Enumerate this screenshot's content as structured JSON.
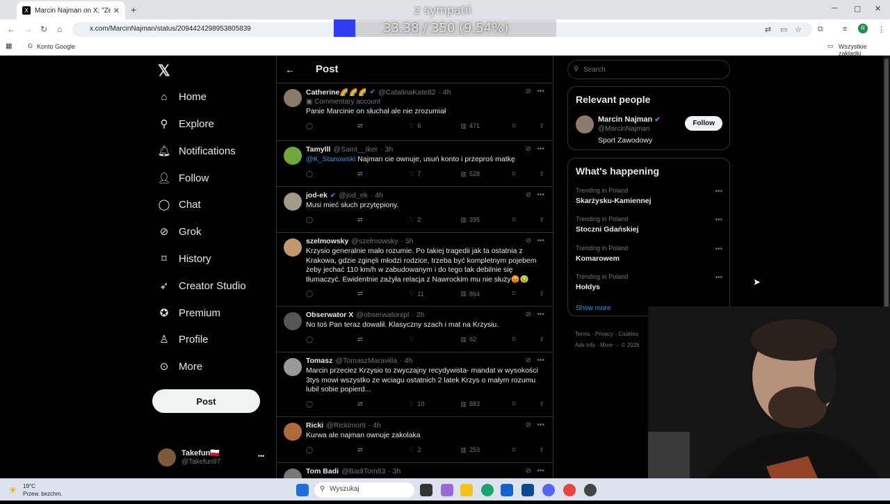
{
  "browser": {
    "tab_title": "Marcin Najman on X: \"Ze wszy",
    "tab_close": "✕",
    "new_tab": "+",
    "url": "x.com/MarcinNajman/status/2094424298953805839",
    "bookmark_google": "Konto Google",
    "bookmark_all": "Wszystkie zakładki",
    "window_min": "─",
    "window_max": "▢",
    "window_close": "✕"
  },
  "overlay": {
    "line1": "z sympatii",
    "line2": "33.38 / 350 (9.54%)",
    "overlay_color": "#2f3cf2",
    "overlay_progress": 0.0954
  },
  "sidebar": {
    "items": [
      {
        "label": "Home",
        "icon": "home-icon"
      },
      {
        "label": "Explore",
        "icon": "search-icon"
      },
      {
        "label": "Notifications",
        "icon": "bell-icon"
      },
      {
        "label": "Follow",
        "icon": "add-user-icon"
      },
      {
        "label": "Chat",
        "icon": "chat-icon"
      },
      {
        "label": "Grok",
        "icon": "grok-icon"
      },
      {
        "label": "History",
        "icon": "bookmark-icon"
      },
      {
        "label": "Creator Studio",
        "icon": "rocket-icon"
      },
      {
        "label": "Premium",
        "icon": "verified-icon"
      },
      {
        "label": "Profile",
        "icon": "person-icon"
      },
      {
        "label": "More",
        "icon": "more-circle-icon"
      }
    ],
    "post_button": "Post",
    "account": {
      "name": "Takefun🇵🇱",
      "handle": "@Takefun97",
      "menu": "•••"
    }
  },
  "main": {
    "back": "←",
    "title": "Post",
    "tweets": [
      {
        "name": "Catherine🌈🌈🌈",
        "handle": "@CatalinaKate82",
        "time": "· 4h",
        "verified": true,
        "badge": "Commentary account",
        "text": "Panie Marcinie on słuchał ale nie zrozumiał",
        "likes": "6",
        "views": "471"
      },
      {
        "name": "Tamylll",
        "handle": "@Saint__Iker",
        "time": "· 3h",
        "mention": "@K_Stanowski",
        "text": " Najman cie ownuje, usuń konto i przeproś matkę",
        "likes": "7",
        "views": "528"
      },
      {
        "name": "jod-ek",
        "handle": "@jod_ek",
        "time": "· 4h",
        "verified": true,
        "text": "Musi mieć słuch przytępiony.",
        "likes": "2",
        "views": "395"
      },
      {
        "name": "szelmowsky",
        "handle": "@szelmowsky",
        "time": "· 5h",
        "text": "Krzysio generalnie mało rozumie. Po takiej tragedii jak ta ostatnia z Krakowa, gdzie zginęli młodzi rodzice, trzeba być kompletnym pojebem żeby jechać 110 km/h w zabudowanym i do tego tak debilnie się tłumaczyć. Ewidentnie zażyła relacja z Nawrockim mu nie służy😡🤢",
        "likes": "11",
        "views": "864"
      },
      {
        "name": "Obserwator X",
        "handle": "@obserwatorxpl",
        "time": "· 2h",
        "text": "No toś Pan teraz dowalił. Klasyczny szach i mat na Krzysiu.",
        "likes": "",
        "views": "62"
      },
      {
        "name": "Tomasz",
        "handle": "@TomaszMaravilla",
        "time": "· 4h",
        "text": "Marcin przeciez Krzysio to zwyczajny recydywista- mandat w wysokości 3tys mowi wszystko ze wciagu ostatnich 2 latek Krzys o małym rozumu lubil sobie popierd...",
        "likes": "10",
        "views": "883"
      },
      {
        "name": "Ricki",
        "handle": "@Rickimorti",
        "time": "· 4h",
        "text": "Kurwa ale najman ownuje zakolaka",
        "likes": "2",
        "views": "253"
      },
      {
        "name": "Tom Badi",
        "handle": "@BadiTom83",
        "time": "· 3h",
        "text": "",
        "likes": "",
        "views": ""
      }
    ]
  },
  "right": {
    "search_placeholder": "Search",
    "relevant_title": "Relevant people",
    "person": {
      "name": "Marcin Najman",
      "handle": "@MarcinNajman",
      "bio": "Sport Zawodowy",
      "follow": "Follow"
    },
    "happening_title": "What's happening",
    "trends": [
      {
        "context": "Trending in Poland",
        "name": "Skarżysku-Kamiennej"
      },
      {
        "context": "Trending in Poland",
        "name": "Stoczni Gdańskiej"
      },
      {
        "context": "Trending in Poland",
        "name": "Komarowem"
      },
      {
        "context": "Trending in Poland",
        "name": "Hołdys"
      }
    ],
    "show_more": "Show more",
    "footer_line1": "Terms · Privacy · Cookies",
    "footer_line2": "Ads info · More ··· © 2026"
  },
  "taskbar": {
    "temp": "19°C",
    "weather": "Przew. bezchm.",
    "search": "Wyszukaj"
  }
}
